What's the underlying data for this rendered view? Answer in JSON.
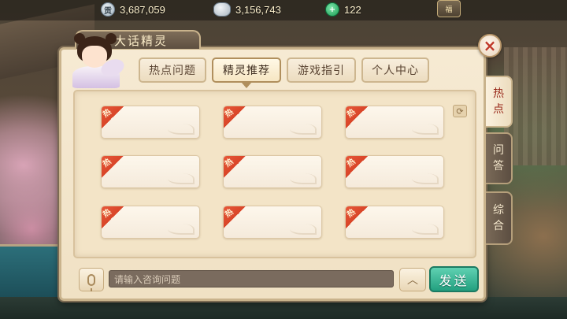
{
  "resources": [
    {
      "icon": "silver-ingot-icon",
      "value": "3,687,059"
    },
    {
      "icon": "silver-pile-icon",
      "value": "3,156,743"
    },
    {
      "icon": "jade-coin-icon",
      "value": "122"
    }
  ],
  "top_badge": {
    "label": "福"
  },
  "dialog": {
    "title": "大话精灵",
    "close_symbol": "×",
    "tabs": [
      {
        "label": "热点问题",
        "active": false
      },
      {
        "label": "精灵推荐",
        "active": true
      },
      {
        "label": "游戏指引",
        "active": false
      },
      {
        "label": "个人中心",
        "active": false
      }
    ],
    "side_tabs": [
      {
        "label": "热点",
        "chars": [
          "热",
          "点"
        ],
        "active": true
      },
      {
        "label": "问答",
        "chars": [
          "问",
          "答"
        ],
        "active": false
      },
      {
        "label": "综合",
        "chars": [
          "综",
          "合"
        ],
        "active": false
      }
    ],
    "hot_tag_text": "热",
    "cards": [
      {
        "row": 1,
        "col": 1,
        "text": ""
      },
      {
        "row": 1,
        "col": 2,
        "text": ""
      },
      {
        "row": 1,
        "col": 3,
        "text": ""
      },
      {
        "row": 2,
        "col": 1,
        "text": ""
      },
      {
        "row": 2,
        "col": 2,
        "text": ""
      },
      {
        "row": 2,
        "col": 3,
        "text": ""
      },
      {
        "row": 3,
        "col": 1,
        "text": ""
      },
      {
        "row": 3,
        "col": 2,
        "text": ""
      },
      {
        "row": 3,
        "col": 3,
        "text": ""
      }
    ],
    "input": {
      "placeholder": "请输入咨询问题",
      "value": ""
    },
    "send_label": "发送",
    "expand_symbol": "︿"
  },
  "colors": {
    "send_button": "#23a07f",
    "hot_tag": "#e85a3c",
    "active_side_tab_text": "#9a2b1c"
  }
}
